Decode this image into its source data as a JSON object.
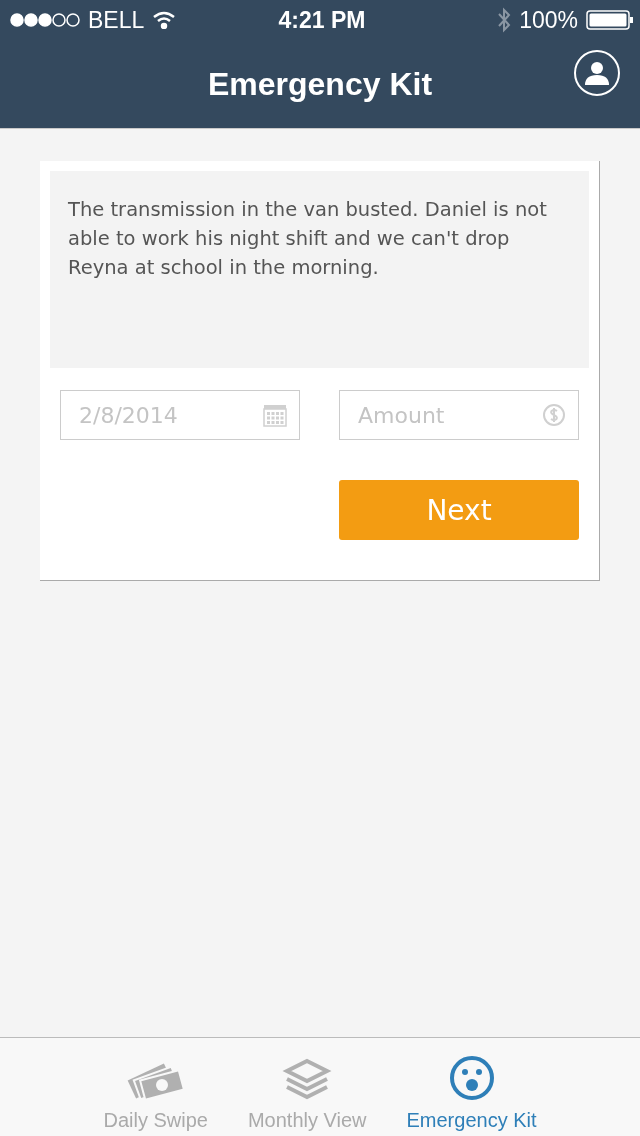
{
  "status_bar": {
    "carrier": "BELL",
    "time": "4:21 PM",
    "battery": "100%"
  },
  "nav_bar": {
    "title": "Emergency Kit"
  },
  "form": {
    "description": "The transmission in the van busted. Daniel is not able to work his night shift and we can't drop Reyna at school in the morning.",
    "date_field": {
      "placeholder": "2/8/2014"
    },
    "amount_field": {
      "placeholder": "Amount"
    },
    "next_button": "Next"
  },
  "tab_bar": [
    {
      "label": "Daily Swipe",
      "kind": "money",
      "selected": false
    },
    {
      "label": "Monthly View",
      "kind": "layers",
      "selected": false
    },
    {
      "label": "Emergency Kit",
      "kind": "face",
      "selected": true
    }
  ]
}
